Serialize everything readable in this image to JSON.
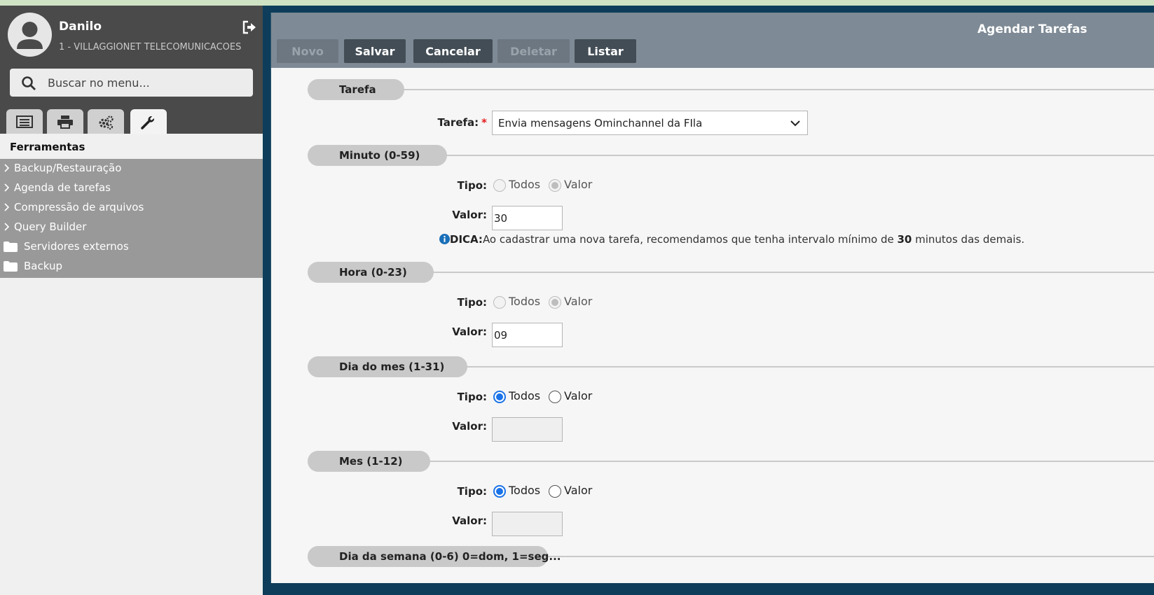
{
  "user": {
    "name": "Danilo",
    "company": "1 - VILLAGGIONET TELECOMUNICACOES"
  },
  "search": {
    "placeholder": "Buscar no menu..."
  },
  "sidebar": {
    "tabs": [
      "list-icon",
      "print-icon",
      "gears-icon",
      "wrench-icon"
    ],
    "active_tab": "wrench-icon",
    "section_title": "Ferramentas",
    "items": [
      {
        "label": "Backup/Restauração",
        "type": "expandable"
      },
      {
        "label": "Agenda de tarefas",
        "type": "expandable"
      },
      {
        "label": "Compressão de arquivos",
        "type": "expandable"
      },
      {
        "label": "Query Builder",
        "type": "expandable"
      },
      {
        "label": "Servidores externos",
        "type": "folder"
      },
      {
        "label": "Backup",
        "type": "folder"
      }
    ]
  },
  "window": {
    "title": "Agendar Tarefas"
  },
  "toolbar": {
    "novo": "Novo",
    "salvar": "Salvar",
    "cancelar": "Cancelar",
    "deletar": "Deletar",
    "listar": "Listar"
  },
  "form": {
    "tarefa": {
      "section": "Tarefa",
      "label": "Tarefa:",
      "required_mark": "*",
      "selected": "Envia mensagens Ominchannel da FIla"
    },
    "minuto": {
      "section": "Minuto (0-59)",
      "tipo_label": "Tipo:",
      "opt_todos": "Todos",
      "opt_valor": "Valor",
      "selected": "Valor",
      "valor_label": "Valor:",
      "valor": "30",
      "tip_prefix": "DICA:",
      "tip_text": "Ao cadastrar uma nova tarefa, recomendamos que tenha intervalo mínimo de ",
      "tip_bold": "30",
      "tip_suffix": " minutos das demais."
    },
    "hora": {
      "section": "Hora (0-23)",
      "tipo_label": "Tipo:",
      "opt_todos": "Todos",
      "opt_valor": "Valor",
      "selected": "Valor",
      "valor_label": "Valor:",
      "valor": "09"
    },
    "dia_mes": {
      "section": "Dia do mes (1-31)",
      "tipo_label": "Tipo:",
      "opt_todos": "Todos",
      "opt_valor": "Valor",
      "selected": "Todos",
      "valor_label": "Valor:",
      "valor": ""
    },
    "mes": {
      "section": "Mes (1-12)",
      "tipo_label": "Tipo:",
      "opt_todos": "Todos",
      "opt_valor": "Valor",
      "selected": "Todos",
      "valor_label": "Valor:",
      "valor": ""
    },
    "dia_semana": {
      "section": "Dia da semana (0-6) 0=dom, 1=seg..."
    }
  },
  "colors": {
    "accent": "#1a73e8",
    "toolbar": "#7e8a95",
    "button": "#434d56",
    "sidebar_header": "#4a4a4a",
    "required": "#e41b1b"
  }
}
